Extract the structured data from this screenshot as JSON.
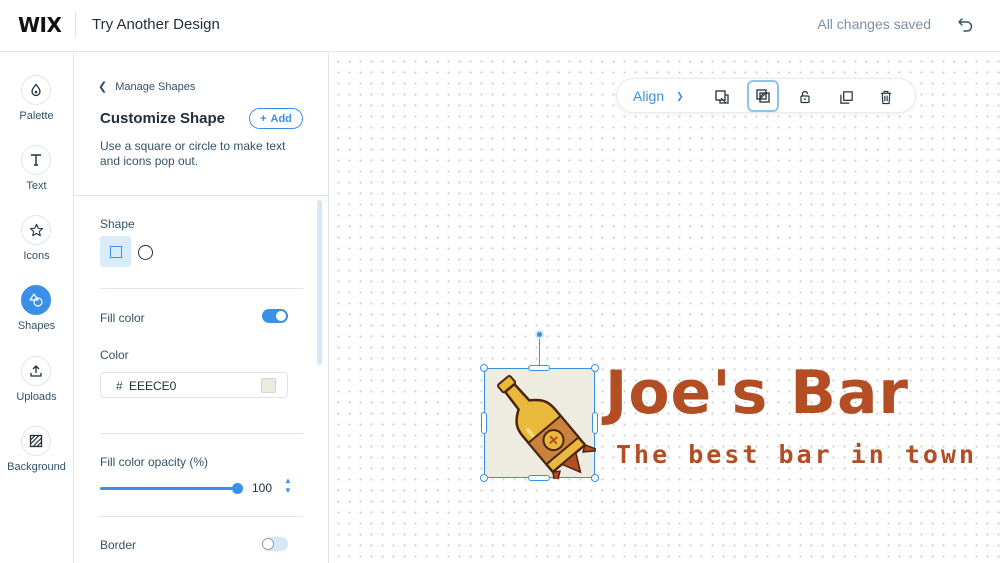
{
  "header": {
    "logo": "WIX",
    "doc_title": "Try Another Design",
    "status": "All changes saved",
    "undo_icon": "undo-icon"
  },
  "leftnav": {
    "items": [
      {
        "label": "Palette",
        "icon": "palette-icon",
        "active": false
      },
      {
        "label": "Text",
        "icon": "text-icon",
        "active": false
      },
      {
        "label": "Icons",
        "icon": "star-icon",
        "active": false
      },
      {
        "label": "Shapes",
        "icon": "shapes-icon",
        "active": true
      },
      {
        "label": "Uploads",
        "icon": "upload-icon",
        "active": false
      },
      {
        "label": "Background",
        "icon": "background-icon",
        "active": false
      }
    ]
  },
  "panel": {
    "back_label": "Manage Shapes",
    "title": "Customize Shape",
    "add_label": "Add",
    "description": "Use a square or circle to make text and icons pop out.",
    "shape_label": "Shape",
    "fill_color_label": "Fill color",
    "fill_color_on": true,
    "color_label": "Color",
    "color_hash": "#",
    "color_value": "EEECE0",
    "opacity_label": "Fill color opacity (%)",
    "opacity_value": "100",
    "border_label": "Border",
    "border_on": false
  },
  "toolbar": {
    "align_label": "Align",
    "icons": [
      "bring-forward-icon",
      "mask-icon",
      "lock-icon",
      "duplicate-icon",
      "delete-icon"
    ]
  },
  "canvas": {
    "brand_name": "Joe's Bar",
    "tagline": "The best bar in town",
    "shape_fill": "#EEECE0",
    "text_color": "#B24D24"
  },
  "colors": {
    "accent": "#3B8FE6",
    "brand": "#B24D24",
    "bottle_yellow": "#E8B93A"
  }
}
